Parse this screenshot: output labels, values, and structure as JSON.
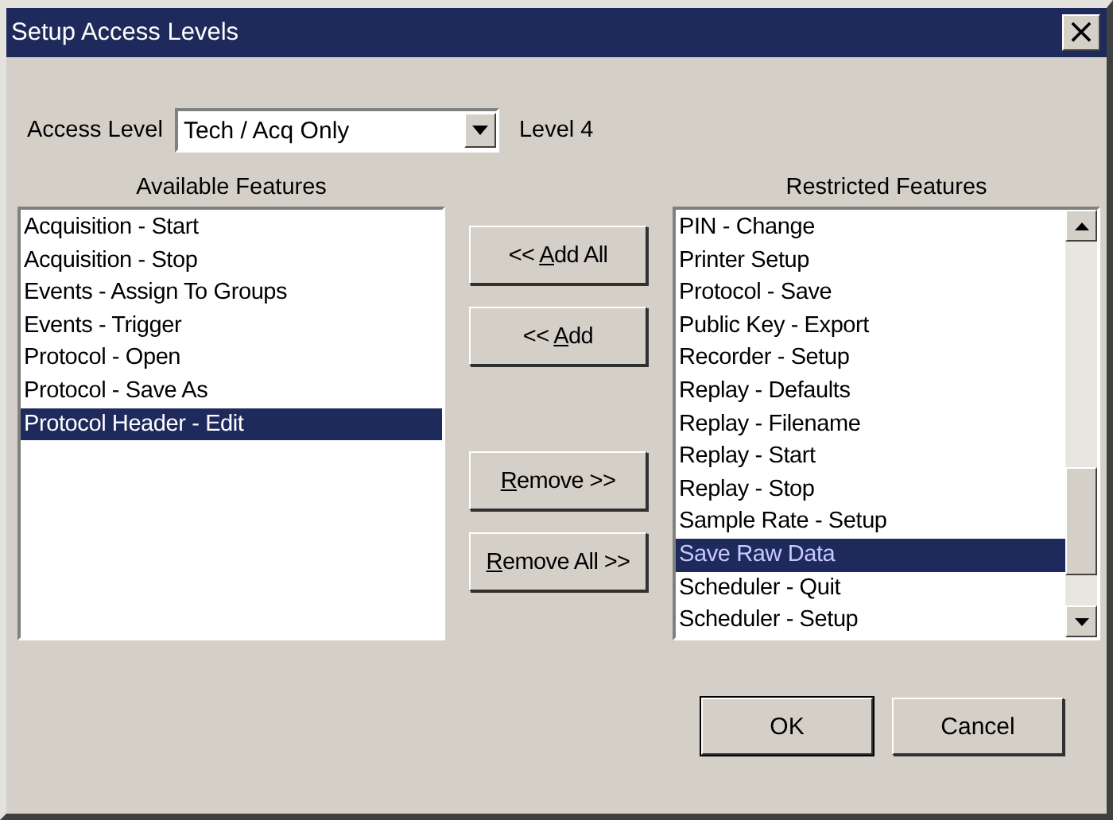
{
  "window": {
    "title": "Setup Access Levels",
    "close": "×"
  },
  "access_level": {
    "label": "Access Level",
    "value": "Tech / Acq Only",
    "level_text": "Level 4"
  },
  "available": {
    "heading": "Available Features",
    "items": [
      {
        "text": "Acquisition - Start",
        "selected": false
      },
      {
        "text": "Acquisition - Stop",
        "selected": false
      },
      {
        "text": "Events - Assign To Groups",
        "selected": false
      },
      {
        "text": "Events - Trigger",
        "selected": false
      },
      {
        "text": "Protocol - Open",
        "selected": false
      },
      {
        "text": "Protocol - Save As",
        "selected": false
      },
      {
        "text": "Protocol Header - Edit",
        "selected": true
      }
    ]
  },
  "transfer_buttons": [
    {
      "before": "<< ",
      "key": "A",
      "after": "dd All"
    },
    {
      "before": "<< ",
      "key": "A",
      "after": "dd"
    },
    {
      "key": "R",
      "after": "emove >>"
    },
    {
      "key": "R",
      "after": "emove All >>"
    }
  ],
  "restricted": {
    "heading": "Restricted Features",
    "items": [
      {
        "text": "PIN - Change",
        "selected": false
      },
      {
        "text": "Printer Setup",
        "selected": false
      },
      {
        "text": "Protocol - Save",
        "selected": false
      },
      {
        "text": "Public Key - Export",
        "selected": false
      },
      {
        "text": "Recorder - Setup",
        "selected": false
      },
      {
        "text": "Replay - Defaults",
        "selected": false
      },
      {
        "text": "Replay - Filename",
        "selected": false
      },
      {
        "text": "Replay - Start",
        "selected": false
      },
      {
        "text": "Replay - Stop",
        "selected": false
      },
      {
        "text": "Sample Rate - Setup",
        "selected": false
      },
      {
        "text": "Save Raw Data",
        "selected": true
      },
      {
        "text": "Scheduler - Quit",
        "selected": false
      },
      {
        "text": "Scheduler - Setup",
        "selected": false
      }
    ]
  },
  "buttons": [
    {
      "label": "OK",
      "default": true
    },
    {
      "label": "Cancel",
      "default": false
    }
  ]
}
